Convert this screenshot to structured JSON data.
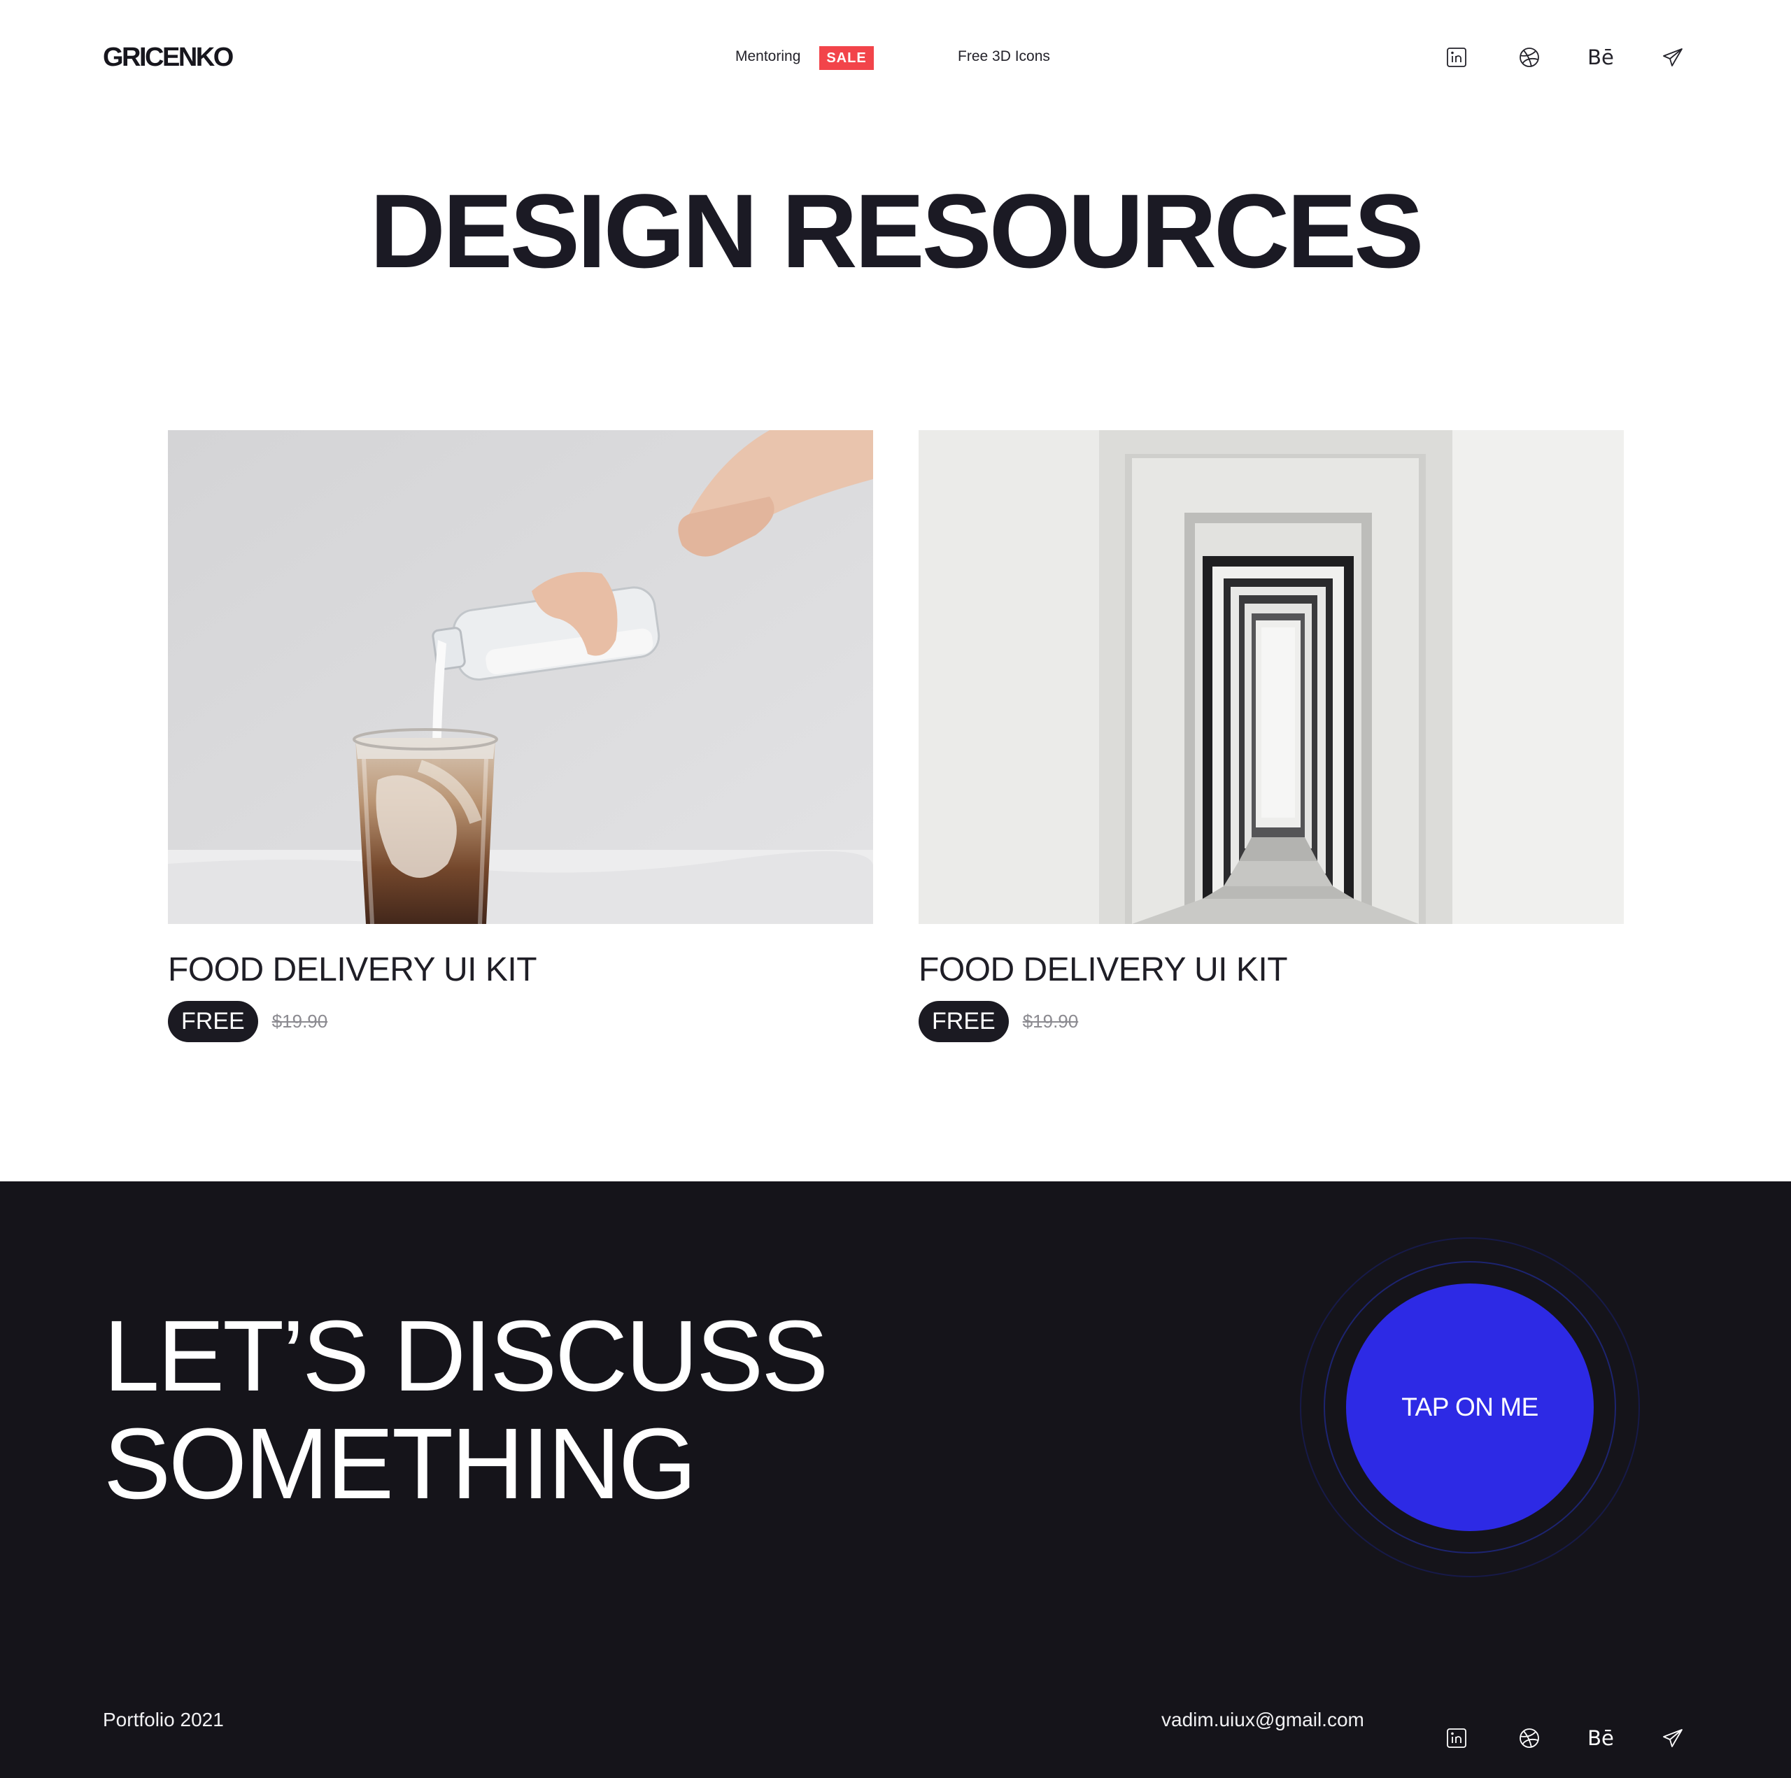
{
  "header": {
    "logo": "GRICENKO",
    "nav": [
      {
        "label": "Mentoring",
        "badge": "SALE"
      },
      {
        "label": "Free 3D Icons"
      }
    ],
    "socials": [
      "linkedin-icon",
      "dribbble-icon",
      "behance-icon",
      "telegram-icon"
    ],
    "behance_label": "Bē"
  },
  "title": "DESIGN RESOURCES",
  "cards": [
    {
      "title": "FOOD DELIVERY UI KIT",
      "badge": "FREE",
      "old_price": "$19.90",
      "image": "iced coffee with milk being poured"
    },
    {
      "title": "FOOD DELIVERY UI KIT",
      "badge": "FREE",
      "old_price": "$19.90",
      "image": "receding white doorways corridor"
    }
  ],
  "cta": {
    "line1": "LET’S DISCUSS",
    "line2": "SOMETHING",
    "button": "TAP ON ME"
  },
  "footer": {
    "left": "Portfolio 2021",
    "email": "vadim.uiux@gmail.com",
    "behance_label": "Bē"
  },
  "colors": {
    "sale": "#f2444a",
    "dark_bg": "#15141a",
    "cta_button": "#2d2ae5",
    "text_dark": "#1b1a22"
  }
}
